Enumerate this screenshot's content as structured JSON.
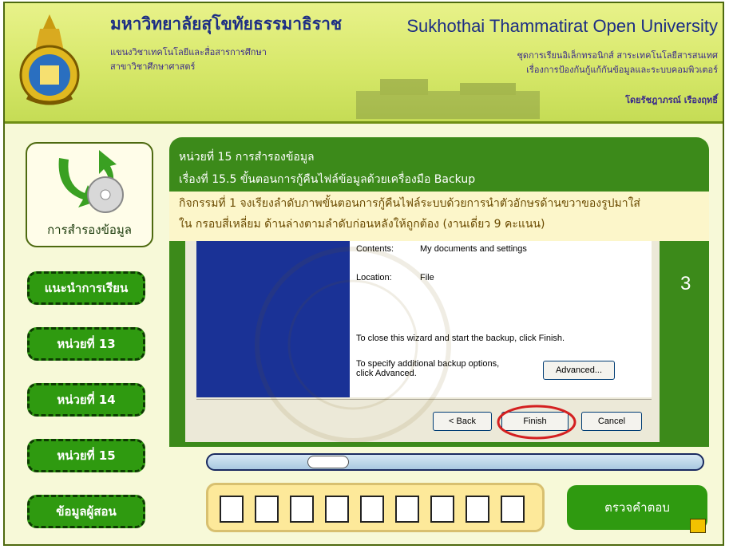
{
  "header": {
    "university_th": "มหาวิทยาลัยสุโขทัยธรรมาธิราช",
    "faculty_th_1": "แขนงวิชาเทคโนโลยีและสื่อสารการศึกษา",
    "faculty_th_2": "สาขาวิชาศึกษาศาสตร์",
    "university_en": "Sukhothai Thammatirat Open University",
    "course_1": "ชุดการเรียนอิเล็กทรอนิกส์ สาระเทคโนโลยีสารสนเทศ",
    "course_2": "เรื่องการป้องกันกู้แก้กันข้อมูลและระบบคอมพิวเตอร์",
    "author": "โดยรัชฎาภรณ์ เรืองฤทธิ์"
  },
  "sidebar": {
    "card_label": "การสำรองข้อมูล",
    "items": [
      {
        "label": "แนะนำการเรียน"
      },
      {
        "label": "หน่วยที่ 13"
      },
      {
        "label": "หน่วยที่ 14"
      },
      {
        "label": "หน่วยที่ 15"
      },
      {
        "label": "ข้อมูลผู้สอน"
      }
    ]
  },
  "content": {
    "unit_title": "หน่วยที่ 15 การสำรองข้อมูล",
    "topic": "เรื่องที่ 15.5 ขั้นตอนการกู้คืนไฟล์ข้อมูลด้วยเครื่องมือ Backup",
    "activity_line1": "กิจกรรมที่ 1 จงเรียงลำดับภาพขั้นตอนการกู้คืนไฟล์ระบบด้วยการนำตัวอักษรด้านขวาของรูปมาใส่",
    "activity_line2": "ใน กรอบสี่เหลี่ยม ด้านล่างตามลำดับก่อนหลังให้ถูกต้อง (งานเดี่ยว 9 คะแนน)",
    "image_number": "3"
  },
  "wizard": {
    "contents_label": "Contents:",
    "contents_value": "My documents and settings",
    "location_label": "Location:",
    "location_value": "File",
    "close_text": "To close this wizard and start the backup, click Finish.",
    "advanced_text_1": "To specify additional backup options,",
    "advanced_text_2": "click Advanced.",
    "advanced_button": "Advanced...",
    "back_button": "< Back",
    "finish_button": "Finish",
    "cancel_button": "Cancel"
  },
  "progress": {
    "value": 0.22
  },
  "answer": {
    "slots": [
      "",
      "",
      "",
      "",
      "",
      "",
      "",
      "",
      ""
    ]
  },
  "check_button": "ตรวจคำตอบ",
  "colors": {
    "nav_green": "#2f9a10",
    "panel_green": "#3c8a1a",
    "header_yellow": "#d7e86a",
    "highlight_red": "#d42020"
  },
  "icons": [
    "university-seal-icon",
    "backup-disc-icon",
    "speaker-icon"
  ]
}
